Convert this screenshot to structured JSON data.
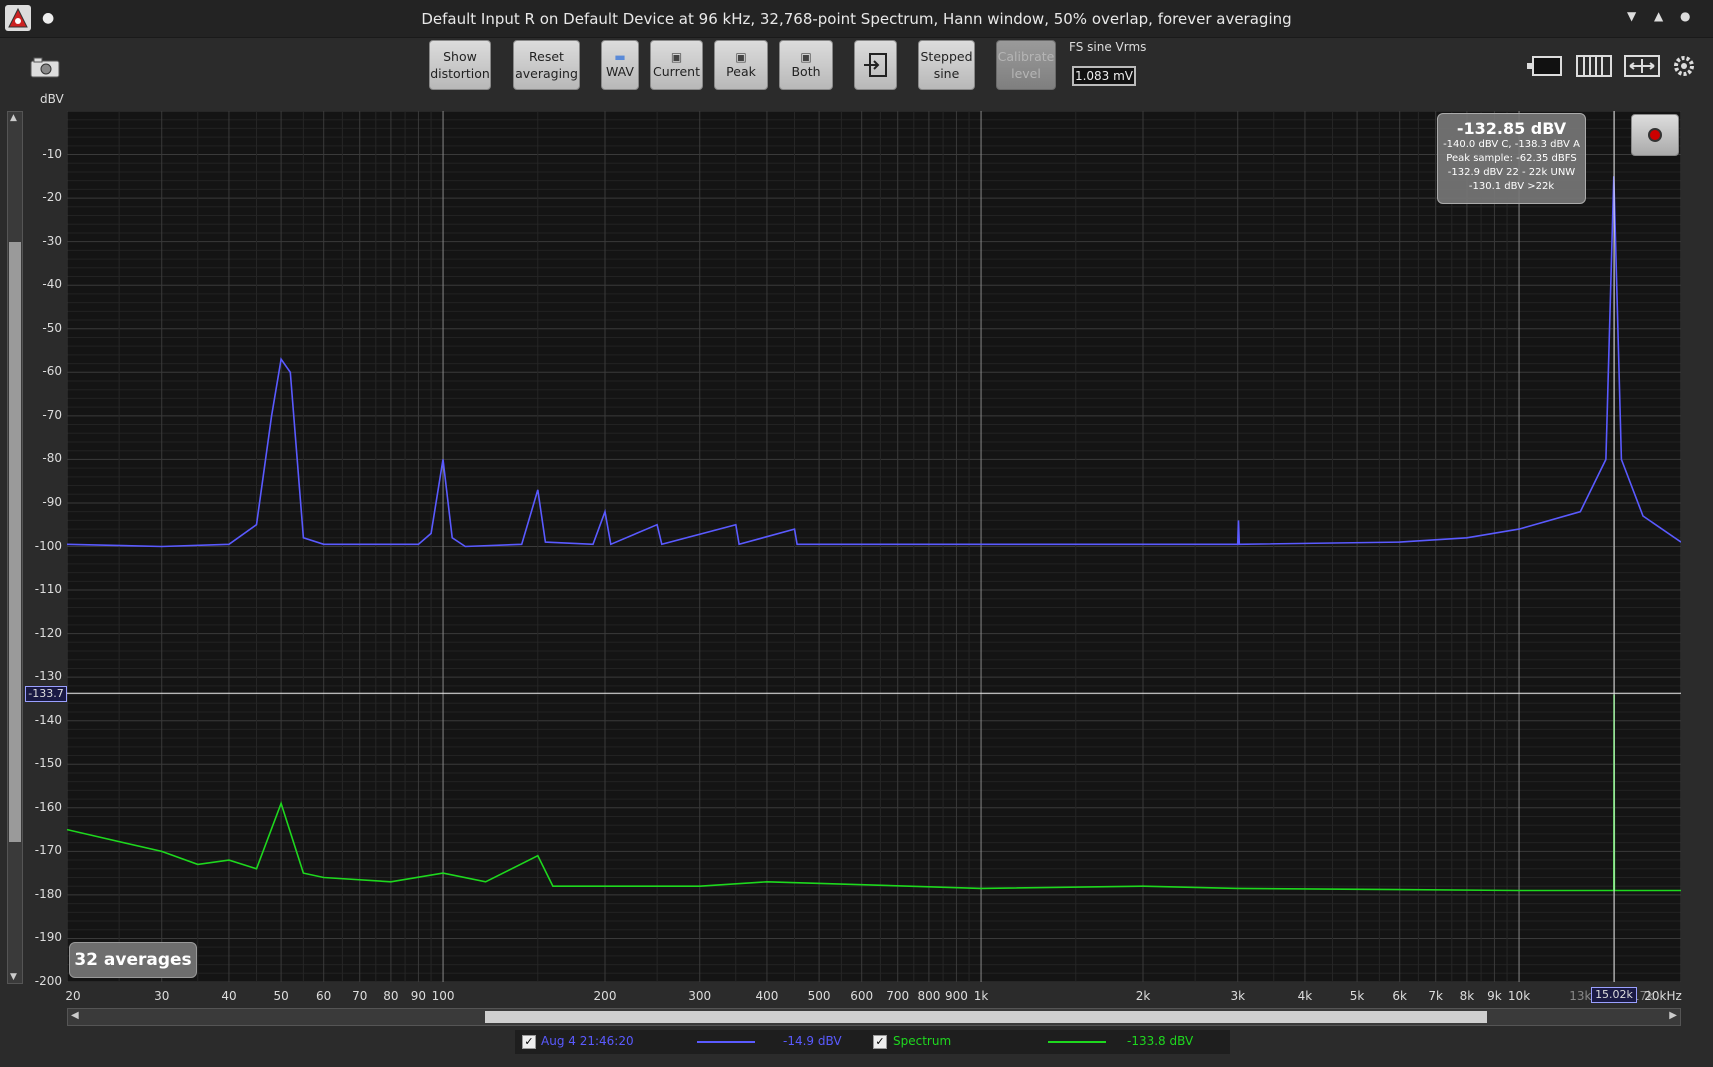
{
  "window": {
    "title": "Default Input R on Default Device at 96 kHz, 32,768-point Spectrum, Hann window, 50% overlap, forever averaging"
  },
  "toolbar": {
    "show_distortion": [
      "Show",
      "distortion"
    ],
    "reset_averaging": [
      "Reset",
      "averaging"
    ],
    "wav": "WAV",
    "current": "Current",
    "peak": "Peak",
    "both": "Both",
    "stepped_sine": [
      "Stepped",
      "sine"
    ],
    "calibrate_level": [
      "Calibrate",
      "level"
    ],
    "fs_label": "FS sine Vrms",
    "fs_value": "1.083 mV"
  },
  "plot": {
    "y_unit": "dBV",
    "y_ticks": [
      "-10",
      "-20",
      "-30",
      "-40",
      "-50",
      "-60",
      "-70",
      "-80",
      "-90",
      "-100",
      "-110",
      "-120",
      "-130",
      "-140",
      "-150",
      "-160",
      "-170",
      "-180",
      "-190",
      "-200"
    ],
    "x_ticks": [
      {
        "label": "20",
        "f": 20
      },
      {
        "label": "30",
        "f": 30
      },
      {
        "label": "40",
        "f": 40
      },
      {
        "label": "50",
        "f": 50
      },
      {
        "label": "60",
        "f": 60
      },
      {
        "label": "70",
        "f": 70
      },
      {
        "label": "80",
        "f": 80
      },
      {
        "label": "90",
        "f": 90
      },
      {
        "label": "100",
        "f": 100
      },
      {
        "label": "200",
        "f": 200
      },
      {
        "label": "300",
        "f": 300
      },
      {
        "label": "400",
        "f": 400
      },
      {
        "label": "500",
        "f": 500
      },
      {
        "label": "600",
        "f": 600
      },
      {
        "label": "700",
        "f": 700
      },
      {
        "label": "800",
        "f": 800
      },
      {
        "label": "900",
        "f": 900
      },
      {
        "label": "1k",
        "f": 1000
      },
      {
        "label": "2k",
        "f": 2000
      },
      {
        "label": "3k",
        "f": 3000
      },
      {
        "label": "4k",
        "f": 4000
      },
      {
        "label": "5k",
        "f": 5000
      },
      {
        "label": "6k",
        "f": 6000
      },
      {
        "label": "7k",
        "f": 7000
      },
      {
        "label": "8k",
        "f": 8000
      },
      {
        "label": "9k",
        "f": 9000
      },
      {
        "label": "10k",
        "f": 10000
      },
      {
        "label": "13k",
        "f": 13000
      },
      {
        "label": "17k",
        "f": 17000
      },
      {
        "label": "20kHz",
        "f": 20000
      }
    ],
    "cursor_y_label": "-133.7",
    "cursor_x_label": "15.02k",
    "averages_label": "32 averages"
  },
  "readout": {
    "value": "-132.85 dBV",
    "lines": [
      "-140.0 dBV C, -138.3 dBV A",
      "Peak sample: -62.35 dBFS",
      "-132.9 dBV 22 - 22k UNW",
      "-130.1 dBV >22k"
    ]
  },
  "legend": {
    "trace1_label": "Aug 4 21:46:20",
    "trace1_value": "-14.9 dBV",
    "trace2_label": "Spectrum",
    "trace2_value": "-133.8 dBV"
  },
  "colors": {
    "trace_blue": "#5a5aff",
    "trace_green": "#1ed81e",
    "plot_bg": "#141414"
  },
  "chart_data": {
    "type": "line",
    "xscale": "log",
    "xlim": [
      20,
      20000
    ],
    "ylim": [
      -200,
      0
    ],
    "ylabel": "dBV",
    "series": [
      {
        "name": "Aug 4 21:46:20",
        "color": "#5a5aff",
        "points": [
          [
            20,
            -99.5
          ],
          [
            30,
            -100
          ],
          [
            40,
            -99.5
          ],
          [
            45,
            -95
          ],
          [
            48,
            -70
          ],
          [
            50,
            -57
          ],
          [
            52,
            -60
          ],
          [
            55,
            -98
          ],
          [
            60,
            -99.5
          ],
          [
            90,
            -99.5
          ],
          [
            95,
            -97
          ],
          [
            100,
            -80
          ],
          [
            104,
            -98
          ],
          [
            110,
            -100
          ],
          [
            140,
            -99.5
          ],
          [
            150,
            -87
          ],
          [
            155,
            -99
          ],
          [
            190,
            -99.5
          ],
          [
            200,
            -92
          ],
          [
            205,
            -99.5
          ],
          [
            250,
            -95
          ],
          [
            255,
            -99.5
          ],
          [
            350,
            -95
          ],
          [
            355,
            -99.5
          ],
          [
            450,
            -96
          ],
          [
            455,
            -99.5
          ],
          [
            1000,
            -99.5
          ],
          [
            3000,
            -99.5
          ],
          [
            3010,
            -94
          ],
          [
            3020,
            -99.5
          ],
          [
            6000,
            -99
          ],
          [
            8000,
            -98
          ],
          [
            10000,
            -96
          ],
          [
            13000,
            -92
          ],
          [
            14500,
            -80
          ],
          [
            15000,
            -15
          ],
          [
            15500,
            -80
          ],
          [
            17000,
            -93
          ],
          [
            20000,
            -99
          ]
        ]
      },
      {
        "name": "Spectrum",
        "color": "#1ed81e",
        "points": [
          [
            20,
            -165
          ],
          [
            30,
            -170
          ],
          [
            35,
            -173
          ],
          [
            40,
            -172
          ],
          [
            45,
            -174
          ],
          [
            50,
            -159
          ],
          [
            55,
            -175
          ],
          [
            60,
            -176
          ],
          [
            80,
            -177
          ],
          [
            100,
            -175
          ],
          [
            120,
            -177
          ],
          [
            150,
            -171
          ],
          [
            160,
            -178
          ],
          [
            300,
            -178
          ],
          [
            400,
            -177
          ],
          [
            1000,
            -178.5
          ],
          [
            2000,
            -178
          ],
          [
            3000,
            -178.5
          ],
          [
            10000,
            -179
          ],
          [
            15000,
            -179
          ],
          [
            15020,
            -134
          ],
          [
            15040,
            -179
          ],
          [
            20000,
            -179
          ]
        ]
      }
    ]
  }
}
